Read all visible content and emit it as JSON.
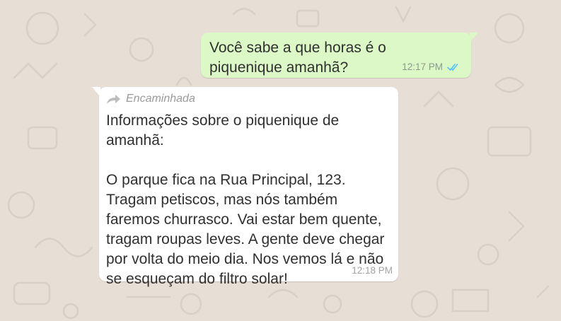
{
  "chat": {
    "messages": [
      {
        "direction": "outgoing",
        "text": "Você sabe a que horas é o\npiquenique amanhã?",
        "time": "12:17 PM",
        "status_icon": "double-check-read-icon"
      },
      {
        "direction": "incoming",
        "forwarded_label": "Encaminhada",
        "text": "Informações sobre o piquenique de\namanhã:\n\nO parque fica na Rua Principal, 123.\nTragam petiscos, mas nós também\nfaremos churrasco. Vai estar bem quente,\ntragam roupas leves. A gente deve chegar\npor volta do meio dia. Nos vemos lá e não\nse esqueçam do filtro solar!",
        "time": "12:18 PM"
      }
    ]
  },
  "colors": {
    "wallpaper": "#e7ded6",
    "outgoing_bubble": "#dcf8c6",
    "incoming_bubble": "#ffffff",
    "read_ticks": "#4fc3f7"
  }
}
